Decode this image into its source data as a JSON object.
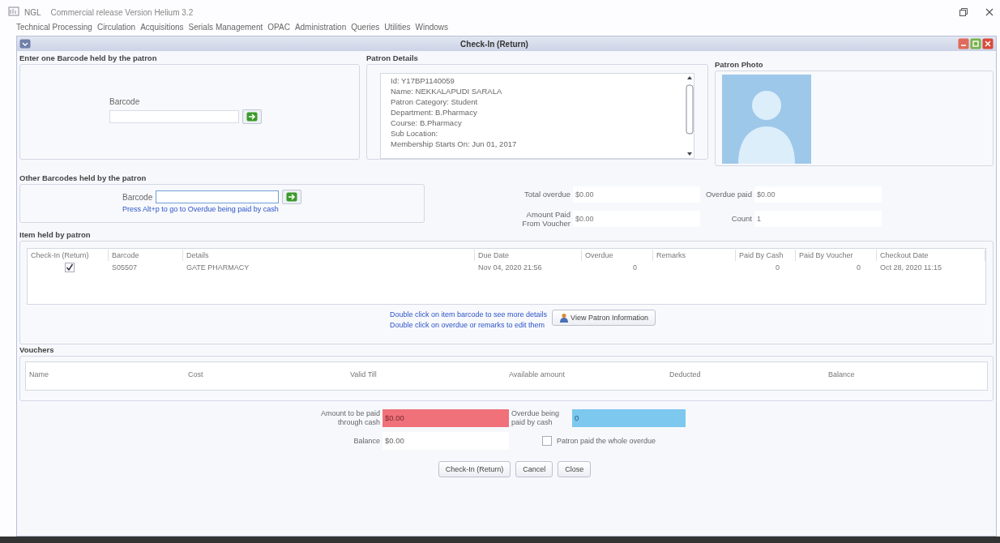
{
  "app": {
    "title": "NGL",
    "subtitle": "Commercial release Version Helium  3.2"
  },
  "menu": [
    "Technical Processing",
    "Circulation",
    "Acquisitions",
    "Serials Management",
    "OPAC",
    "Administration",
    "Queries",
    "Utilities",
    "Windows"
  ],
  "dialog": {
    "title": "Check-In (Return)"
  },
  "barcode_panel": {
    "heading": "Enter one Barcode held by the patron",
    "label": "Barcode"
  },
  "patron_details": {
    "heading": "Patron Details",
    "lines": [
      "Id: Y17BP1140059",
      "Name: NEKKALAPUDI SARALA",
      "Patron Category: Student",
      "Department: B.Pharmacy",
      "Course: B.Pharmacy",
      "Sub Location:",
      "Membership Starts On: Jun 01, 2017"
    ]
  },
  "patron_photo": {
    "heading": "Patron Photo"
  },
  "other_barcodes": {
    "heading": "Other Barcodes held by the patron",
    "label": "Barcode",
    "hint": "Press Alt+p to go to Overdue being paid by cash"
  },
  "totals": [
    {
      "label": "Total overdue",
      "value": "$0.00"
    },
    {
      "label": "Overdue paid",
      "value": "$0.00"
    },
    {
      "label": "Amount Paid From Voucher",
      "value": "$0.00"
    },
    {
      "label": "Count",
      "value": "1"
    }
  ],
  "items": {
    "heading": "Item held by patron",
    "columns": [
      "Check-In (Return)",
      "Barcode",
      "Details",
      "Due Date",
      "Overdue",
      "Remarks",
      "Paid By Cash",
      "Paid By Voucher",
      "Checkout Date"
    ],
    "rows": [
      {
        "checked": true,
        "cells": [
          "",
          "S05507",
          "GATE PHARMACY",
          "Nov 04, 2020 21:56",
          "0",
          "",
          "0",
          "0",
          "Oct 28, 2020 11:15"
        ]
      }
    ]
  },
  "item_hints": [
    "Double click on item barcode to see more details",
    "Double click on overdue or remarks to edit them"
  ],
  "view_button": "View Patron Information",
  "vouchers": {
    "heading": "Vouchers",
    "columns": [
      "Name",
      "Cost",
      "Valid Till",
      "Available amount",
      "Deducted",
      "Balance"
    ]
  },
  "payment": {
    "cash_label": "Amount to be paid through cash",
    "cash_value": "$0.00",
    "overdue_label": "Overdue being paid by cash",
    "overdue_value": "0",
    "balance_label": "Balance",
    "balance_value": "$0.00",
    "whole_overdue": {
      "label": "Patron paid the whole overdue",
      "checked": false
    }
  },
  "buttons": [
    "Check-In (Return)",
    "Cancel",
    "Close"
  ]
}
